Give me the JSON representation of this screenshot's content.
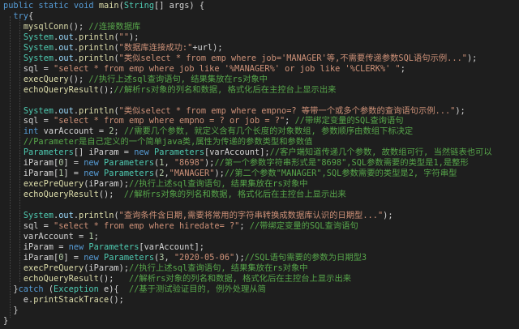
{
  "editor": {
    "lines": [
      [
        {
          "t": "kw",
          "v": "public "
        },
        {
          "t": "kw",
          "v": "static "
        },
        {
          "t": "kw",
          "v": "void "
        },
        {
          "t": "fn",
          "v": "main"
        },
        {
          "t": "pl",
          "v": "("
        },
        {
          "t": "ty",
          "v": "String"
        },
        {
          "t": "pl",
          "v": "[] args) {"
        }
      ],
      [
        {
          "t": "pl",
          "v": "  "
        },
        {
          "t": "kw",
          "v": "try"
        },
        {
          "t": "pl",
          "v": "{"
        }
      ],
      [
        {
          "t": "pl",
          "v": "    "
        },
        {
          "t": "fn",
          "v": "mysqlConn"
        },
        {
          "t": "pl",
          "v": "(); "
        },
        {
          "t": "cm",
          "v": "//连接数据库"
        }
      ],
      [
        {
          "t": "pl",
          "v": "    "
        },
        {
          "t": "cls",
          "v": "System"
        },
        {
          "t": "pl",
          "v": "."
        },
        {
          "t": "vr",
          "v": "out"
        },
        {
          "t": "pl",
          "v": "."
        },
        {
          "t": "fn",
          "v": "println"
        },
        {
          "t": "pl",
          "v": "("
        },
        {
          "t": "st",
          "v": "\"\""
        },
        {
          "t": "pl",
          "v": ");"
        }
      ],
      [
        {
          "t": "pl",
          "v": "    "
        },
        {
          "t": "cls",
          "v": "System"
        },
        {
          "t": "pl",
          "v": "."
        },
        {
          "t": "vr",
          "v": "out"
        },
        {
          "t": "pl",
          "v": "."
        },
        {
          "t": "fn",
          "v": "println"
        },
        {
          "t": "pl",
          "v": "("
        },
        {
          "t": "st",
          "v": "\"数据库连接成功:\""
        },
        {
          "t": "pl",
          "v": "+url);"
        }
      ],
      [
        {
          "t": "pl",
          "v": "    "
        },
        {
          "t": "cls",
          "v": "System"
        },
        {
          "t": "pl",
          "v": "."
        },
        {
          "t": "vr",
          "v": "out"
        },
        {
          "t": "pl",
          "v": "."
        },
        {
          "t": "fn",
          "v": "println"
        },
        {
          "t": "pl",
          "v": "("
        },
        {
          "t": "st",
          "v": "\"类似select * from emp where job='MANAGER'等,不需要传递参数SQL语句示例...\""
        },
        {
          "t": "pl",
          "v": ");"
        }
      ],
      [
        {
          "t": "pl",
          "v": "    sql = "
        },
        {
          "t": "st",
          "v": "\"select * from emp where job like '%MANAGER%' or job like '%CLERK%' \""
        },
        {
          "t": "pl",
          "v": ";"
        }
      ],
      [
        {
          "t": "pl",
          "v": "    "
        },
        {
          "t": "fn",
          "v": "execQuery"
        },
        {
          "t": "pl",
          "v": "(); "
        },
        {
          "t": "cm",
          "v": "//执行上述sql查询语句, 结果集放在rs对象中"
        }
      ],
      [
        {
          "t": "pl",
          "v": "    "
        },
        {
          "t": "fn",
          "v": "echoQueryResult"
        },
        {
          "t": "pl",
          "v": "();"
        },
        {
          "t": "cm",
          "v": "//解析rs对象的列名和数据, 格式化后在主控台上显示出来"
        }
      ],
      [],
      [
        {
          "t": "pl",
          "v": "    "
        },
        {
          "t": "cls",
          "v": "System"
        },
        {
          "t": "pl",
          "v": "."
        },
        {
          "t": "vr",
          "v": "out"
        },
        {
          "t": "pl",
          "v": "."
        },
        {
          "t": "fn",
          "v": "println"
        },
        {
          "t": "pl",
          "v": "("
        },
        {
          "t": "st",
          "v": "\"类似select * from emp where empno=? 等带一个或多个参数的查询语句示例...\""
        },
        {
          "t": "pl",
          "v": ");"
        }
      ],
      [
        {
          "t": "pl",
          "v": "    sql = "
        },
        {
          "t": "st",
          "v": "\"select * from emp where empno = ? or job = ?\""
        },
        {
          "t": "pl",
          "v": "; "
        },
        {
          "t": "cm",
          "v": "//带绑定变量的SQL查询语句"
        }
      ],
      [
        {
          "t": "pl",
          "v": "    "
        },
        {
          "t": "kw",
          "v": "int "
        },
        {
          "t": "pl",
          "v": "varAccount = "
        },
        {
          "t": "nm",
          "v": "2"
        },
        {
          "t": "pl",
          "v": "; "
        },
        {
          "t": "cm",
          "v": "//需要几个参数, 就定义含有几个长度的对象数组, 参数顺序由数组下标决定"
        }
      ],
      [
        {
          "t": "pl",
          "v": "    "
        },
        {
          "t": "cm",
          "v": "//Parameter是自己定义的一个简单java类,属性为传递的参数类型和参数值"
        }
      ],
      [
        {
          "t": "pl",
          "v": "    "
        },
        {
          "t": "cls",
          "v": "Parameters"
        },
        {
          "t": "pl",
          "v": "[] iParam = "
        },
        {
          "t": "kw",
          "v": "new "
        },
        {
          "t": "cls",
          "v": "Parameters"
        },
        {
          "t": "pl",
          "v": "[varAccount];"
        },
        {
          "t": "cm",
          "v": "//客户端知道传递几个参数, 故数组可行, 当然链表也可以"
        }
      ],
      [
        {
          "t": "pl",
          "v": "    iParam["
        },
        {
          "t": "nm",
          "v": "0"
        },
        {
          "t": "pl",
          "v": "] = "
        },
        {
          "t": "kw",
          "v": "new "
        },
        {
          "t": "cls",
          "v": "Parameters"
        },
        {
          "t": "pl",
          "v": "("
        },
        {
          "t": "nm",
          "v": "1"
        },
        {
          "t": "pl",
          "v": ", "
        },
        {
          "t": "st",
          "v": "\"8698\""
        },
        {
          "t": "pl",
          "v": ");"
        },
        {
          "t": "cm",
          "v": "//第一个参数字符串形式是\"8698\",SQL参数需要的类型是1,是整形"
        }
      ],
      [
        {
          "t": "pl",
          "v": "    iParam["
        },
        {
          "t": "nm",
          "v": "1"
        },
        {
          "t": "pl",
          "v": "] = "
        },
        {
          "t": "kw",
          "v": "new "
        },
        {
          "t": "cls",
          "v": "Parameters"
        },
        {
          "t": "pl",
          "v": "("
        },
        {
          "t": "nm",
          "v": "2"
        },
        {
          "t": "pl",
          "v": ","
        },
        {
          "t": "st",
          "v": "\"MANAGER\""
        },
        {
          "t": "pl",
          "v": ");"
        },
        {
          "t": "cm",
          "v": "//第二个参数\"MANAGER\",SQL参数需要的类型是2, 字符串型"
        }
      ],
      [
        {
          "t": "pl",
          "v": "    "
        },
        {
          "t": "fn",
          "v": "execPreQuery"
        },
        {
          "t": "pl",
          "v": "(iParam);"
        },
        {
          "t": "cm",
          "v": "//执行上述sql查询语句, 结果集放在rs对象中"
        }
      ],
      [
        {
          "t": "pl",
          "v": "    "
        },
        {
          "t": "fn",
          "v": "echoQueryResult"
        },
        {
          "t": "pl",
          "v": "();  "
        },
        {
          "t": "cm",
          "v": "//解析rs对象的列名和数据, 格式化后在主控台上显示出来"
        }
      ],
      [],
      [
        {
          "t": "pl",
          "v": "    "
        },
        {
          "t": "cls",
          "v": "System"
        },
        {
          "t": "pl",
          "v": "."
        },
        {
          "t": "vr",
          "v": "out"
        },
        {
          "t": "pl",
          "v": "."
        },
        {
          "t": "fn",
          "v": "println"
        },
        {
          "t": "pl",
          "v": "("
        },
        {
          "t": "st",
          "v": "\"查询条件含日期,需要将常用的字符串转换成数据库认识的日期型...\""
        },
        {
          "t": "pl",
          "v": ");"
        }
      ],
      [
        {
          "t": "pl",
          "v": "    sql = "
        },
        {
          "t": "st",
          "v": "\"select * from emp where hiredate= ?\""
        },
        {
          "t": "pl",
          "v": "; "
        },
        {
          "t": "cm",
          "v": "//带绑定变量的SQL查询语句"
        }
      ],
      [
        {
          "t": "pl",
          "v": "    varAccount = "
        },
        {
          "t": "nm",
          "v": "1"
        },
        {
          "t": "pl",
          "v": ";"
        }
      ],
      [
        {
          "t": "pl",
          "v": "    iParam = "
        },
        {
          "t": "kw",
          "v": "new "
        },
        {
          "t": "cls",
          "v": "Parameters"
        },
        {
          "t": "pl",
          "v": "[varAccount];"
        }
      ],
      [
        {
          "t": "pl",
          "v": "    iParam["
        },
        {
          "t": "nm",
          "v": "0"
        },
        {
          "t": "pl",
          "v": "] = "
        },
        {
          "t": "kw",
          "v": "new "
        },
        {
          "t": "cls",
          "v": "Parameters"
        },
        {
          "t": "pl",
          "v": "("
        },
        {
          "t": "nm",
          "v": "3"
        },
        {
          "t": "pl",
          "v": ", "
        },
        {
          "t": "st",
          "v": "\"2020-05-06\""
        },
        {
          "t": "pl",
          "v": ");"
        },
        {
          "t": "cm",
          "v": "//SQL语句需要的参数为日期型3"
        }
      ],
      [
        {
          "t": "pl",
          "v": "    "
        },
        {
          "t": "fn",
          "v": "execPreQuery"
        },
        {
          "t": "pl",
          "v": "(iParam);"
        },
        {
          "t": "cm",
          "v": "//执行上述sql查询语句, 结果集放在rs对象中"
        }
      ],
      [
        {
          "t": "pl",
          "v": "    "
        },
        {
          "t": "fn",
          "v": "echoQueryResult"
        },
        {
          "t": "pl",
          "v": "();   "
        },
        {
          "t": "cm",
          "v": "//解析rs对象的列名和数据, 格式化后在主控台上显示出来"
        }
      ],
      [
        {
          "t": "pl",
          "v": "  }"
        },
        {
          "t": "kw",
          "v": "catch "
        },
        {
          "t": "pl",
          "v": "("
        },
        {
          "t": "ex",
          "v": "Exception "
        },
        {
          "t": "pl",
          "v": "e){  "
        },
        {
          "t": "cm",
          "v": "//基于测试验证目的, 例外处理从简"
        }
      ],
      [
        {
          "t": "pl",
          "v": "    e."
        },
        {
          "t": "fn",
          "v": "printStackTrace"
        },
        {
          "t": "pl",
          "v": "();"
        }
      ],
      [
        {
          "t": "pl",
          "v": "  }"
        }
      ],
      [
        {
          "t": "pl",
          "v": "}"
        }
      ]
    ]
  },
  "colors": {
    "background": "#1e1e1e",
    "keyword": "#569cd6",
    "type": "#4ec9b0",
    "function": "#dcdcaa",
    "string": "#ce9178",
    "comment": "#57a64a",
    "number": "#b5cea8",
    "variable": "#9cdcfe",
    "plain": "#d4d4d4"
  }
}
